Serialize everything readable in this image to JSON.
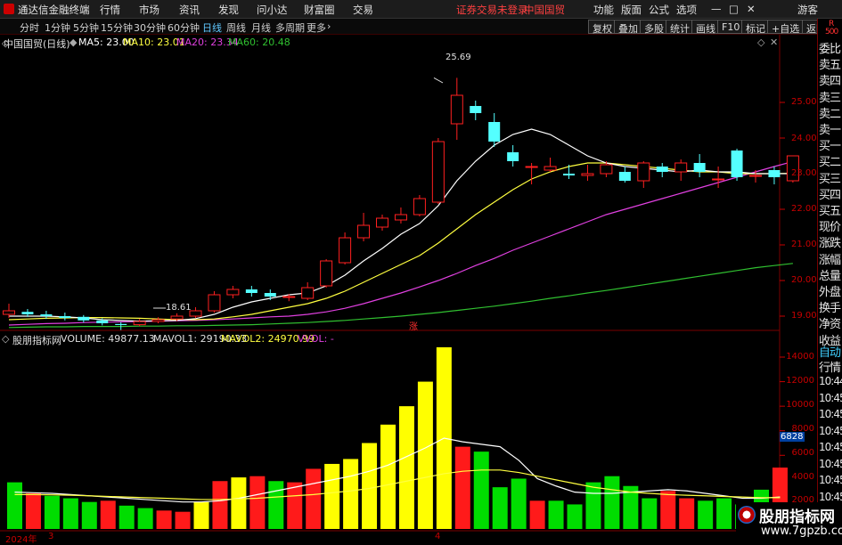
{
  "app": {
    "title": "通达信金融终端",
    "login_status": "证券交易未登录",
    "stock_name_title": "中国国贸",
    "guest": "游客"
  },
  "menu": [
    "行情",
    "市场",
    "资讯",
    "发现",
    "问小达",
    "财富圈",
    "交易"
  ],
  "top_right": [
    "功能",
    "版面",
    "公式",
    "选项"
  ],
  "periods": [
    "分时",
    "1分钟",
    "5分钟",
    "15分钟",
    "30分钟",
    "60分钟",
    "日线",
    "周线",
    "月线",
    "多周期",
    "更多"
  ],
  "active_period": "日线",
  "toolbar_right": [
    "复权",
    "叠加",
    "多股",
    "统计",
    "画线",
    "F10",
    "标记",
    "+自选",
    "返回"
  ],
  "price_header": {
    "name": "中国国贸(日线)",
    "ma5": "MA5: 23.00",
    "ma10": "MA10: 23.01",
    "ma20": "MA20: 23.34",
    "ma60": "MA60: 20.48"
  },
  "price_annotations": {
    "high": "25.69",
    "low": "18.61",
    "zhang": "涨"
  },
  "price_ticks": [
    "25.00",
    "24.00",
    "23.00",
    "22.00",
    "21.00",
    "20.00",
    "19.00"
  ],
  "vol_header": {
    "name": "股朋指标网",
    "volume": "VOLUME: 49877.13",
    "mavol1": "MAVOL1: 29190.33",
    "mavol2": "MAVOL2: 24970.99",
    "vvol": "VVOL: -"
  },
  "vol_ticks": [
    "14000",
    "12000",
    "10000",
    "8000",
    "6000",
    "4000",
    "2000"
  ],
  "vol_cursor": "6828",
  "date_axis": {
    "year": "2024年",
    "m1": "3",
    "m2": "4"
  },
  "right_panel": [
    "委比",
    "卖五",
    "卖四",
    "卖三",
    "卖二",
    "卖一",
    "买一",
    "买二",
    "买三",
    "买四",
    "买五",
    "现价",
    "涨跌",
    "涨幅",
    "总量",
    "外盘",
    "换手",
    "净资",
    "收益"
  ],
  "right_top": {
    "r": "R",
    "n": "500"
  },
  "right_lower": [
    "自动",
    "行情"
  ],
  "tick_times": [
    "10:44",
    "10:45",
    "10:45",
    "10:45",
    "10:45",
    "10:45",
    "10:45",
    "10:45",
    "10:45"
  ],
  "watermark": {
    "name": "股朋指标网",
    "url": "www.7gpzb.com"
  },
  "colors": {
    "up": "#ff2020",
    "down": "#54ffff",
    "ma5": "#ffffff",
    "ma10": "#ffff40",
    "ma20": "#e040e0",
    "ma60": "#30c030",
    "vol_up": "#ff1a1a",
    "vol_down": "#00dd00",
    "vol_yellow": "#ffff00"
  },
  "chart_data": {
    "type": "candlestick",
    "ylim": [
      18.2,
      26.0
    ],
    "candles": [
      {
        "o": 19.05,
        "c": 19.15,
        "h": 19.35,
        "l": 18.95
      },
      {
        "o": 19.12,
        "c": 19.05,
        "h": 19.2,
        "l": 18.98
      },
      {
        "o": 19.05,
        "c": 19.0,
        "h": 19.15,
        "l": 18.92
      },
      {
        "o": 19.0,
        "c": 18.95,
        "h": 19.1,
        "l": 18.88
      },
      {
        "o": 18.98,
        "c": 18.88,
        "h": 19.03,
        "l": 18.82
      },
      {
        "o": 18.88,
        "c": 18.8,
        "h": 18.94,
        "l": 18.74
      },
      {
        "o": 18.78,
        "c": 18.75,
        "h": 18.83,
        "l": 18.61
      },
      {
        "o": 18.76,
        "c": 18.85,
        "h": 18.92,
        "l": 18.72
      },
      {
        "o": 18.85,
        "c": 18.9,
        "h": 18.97,
        "l": 18.8
      },
      {
        "o": 18.92,
        "c": 19.0,
        "h": 19.08,
        "l": 18.86
      },
      {
        "o": 19.0,
        "c": 19.15,
        "h": 19.25,
        "l": 18.95
      },
      {
        "o": 19.15,
        "c": 19.6,
        "h": 19.7,
        "l": 19.1
      },
      {
        "o": 19.6,
        "c": 19.75,
        "h": 19.85,
        "l": 19.5
      },
      {
        "o": 19.75,
        "c": 19.65,
        "h": 19.85,
        "l": 19.55
      },
      {
        "o": 19.65,
        "c": 19.55,
        "h": 19.75,
        "l": 19.45
      },
      {
        "o": 19.55,
        "c": 19.55,
        "h": 19.62,
        "l": 19.42
      },
      {
        "o": 19.5,
        "c": 19.8,
        "h": 19.95,
        "l": 19.45
      },
      {
        "o": 19.85,
        "c": 20.55,
        "h": 20.6,
        "l": 19.8
      },
      {
        "o": 20.5,
        "c": 21.2,
        "h": 21.35,
        "l": 20.45
      },
      {
        "o": 21.2,
        "c": 21.55,
        "h": 21.9,
        "l": 21.1
      },
      {
        "o": 21.5,
        "c": 21.75,
        "h": 21.85,
        "l": 21.4
      },
      {
        "o": 21.7,
        "c": 21.85,
        "h": 22.05,
        "l": 21.6
      },
      {
        "o": 21.85,
        "c": 22.3,
        "h": 22.4,
        "l": 21.8
      },
      {
        "o": 22.2,
        "c": 23.9,
        "h": 24.0,
        "l": 22.15
      },
      {
        "o": 24.4,
        "c": 25.2,
        "h": 25.69,
        "l": 23.95
      },
      {
        "o": 24.9,
        "c": 24.7,
        "h": 25.05,
        "l": 24.5
      },
      {
        "o": 24.45,
        "c": 23.9,
        "h": 24.7,
        "l": 23.75
      },
      {
        "o": 23.6,
        "c": 23.35,
        "h": 23.8,
        "l": 23.2
      },
      {
        "o": 23.2,
        "c": 23.2,
        "h": 23.3,
        "l": 22.7
      },
      {
        "o": 23.1,
        "c": 23.2,
        "h": 23.45,
        "l": 23.05
      },
      {
        "o": 23.0,
        "c": 22.95,
        "h": 23.25,
        "l": 22.85
      },
      {
        "o": 22.95,
        "c": 23.0,
        "h": 23.25,
        "l": 22.8
      },
      {
        "o": 23.0,
        "c": 23.25,
        "h": 23.35,
        "l": 22.9
      },
      {
        "o": 23.05,
        "c": 22.8,
        "h": 23.2,
        "l": 22.75
      },
      {
        "o": 22.8,
        "c": 23.3,
        "h": 23.35,
        "l": 22.6
      },
      {
        "o": 23.2,
        "c": 23.05,
        "h": 23.3,
        "l": 22.9
      },
      {
        "o": 23.05,
        "c": 23.3,
        "h": 23.4,
        "l": 22.8
      },
      {
        "o": 23.3,
        "c": 23.05,
        "h": 23.55,
        "l": 22.9
      },
      {
        "o": 22.85,
        "c": 22.85,
        "h": 23.2,
        "l": 22.6
      },
      {
        "o": 23.65,
        "c": 22.9,
        "h": 23.7,
        "l": 22.8
      },
      {
        "o": 22.95,
        "c": 22.95,
        "h": 23.1,
        "l": 22.75
      },
      {
        "o": 23.1,
        "c": 22.9,
        "h": 23.2,
        "l": 22.7
      },
      {
        "o": 22.8,
        "c": 23.5,
        "h": 23.5,
        "l": 22.75
      }
    ],
    "ma5": [
      19.0,
      19.0,
      19.0,
      18.98,
      18.95,
      18.9,
      18.88,
      18.86,
      18.87,
      18.88,
      18.93,
      19.05,
      19.25,
      19.4,
      19.5,
      19.6,
      19.65,
      19.85,
      20.15,
      20.55,
      20.9,
      21.3,
      21.6,
      22.1,
      22.8,
      23.35,
      23.8,
      24.1,
      24.25,
      24.1,
      23.8,
      23.5,
      23.3,
      23.2,
      23.15,
      23.1,
      23.05,
      23.1,
      23.05,
      23.05,
      23.0,
      23.0,
      23.0
    ],
    "ma10": [
      18.9,
      18.92,
      18.94,
      18.95,
      18.96,
      18.96,
      18.95,
      18.94,
      18.92,
      18.9,
      18.9,
      18.92,
      18.98,
      19.05,
      19.15,
      19.25,
      19.35,
      19.5,
      19.7,
      19.95,
      20.2,
      20.45,
      20.7,
      21.05,
      21.45,
      21.85,
      22.2,
      22.55,
      22.85,
      23.05,
      23.2,
      23.3,
      23.3,
      23.25,
      23.2,
      23.15,
      23.1,
      23.05,
      23.05,
      23.0,
      23.0,
      23.0,
      23.01
    ],
    "ma20": [
      18.75,
      18.77,
      18.79,
      18.8,
      18.82,
      18.83,
      18.84,
      18.85,
      18.86,
      18.87,
      18.88,
      18.9,
      18.92,
      18.95,
      18.98,
      19.0,
      19.05,
      19.12,
      19.22,
      19.35,
      19.5,
      19.65,
      19.82,
      20.0,
      20.2,
      20.42,
      20.62,
      20.85,
      21.05,
      21.25,
      21.45,
      21.65,
      21.85,
      22.0,
      22.15,
      22.3,
      22.45,
      22.6,
      22.75,
      22.9,
      23.05,
      23.2,
      23.34
    ],
    "ma60": [
      18.68,
      18.69,
      18.7,
      18.7,
      18.71,
      18.71,
      18.71,
      18.72,
      18.72,
      18.73,
      18.73,
      18.74,
      18.75,
      18.76,
      18.78,
      18.8,
      18.82,
      18.85,
      18.88,
      18.92,
      18.96,
      19.0,
      19.05,
      19.1,
      19.16,
      19.22,
      19.28,
      19.35,
      19.42,
      19.5,
      19.57,
      19.65,
      19.72,
      19.8,
      19.88,
      19.96,
      20.04,
      20.12,
      20.2,
      20.28,
      20.36,
      20.42,
      20.48
    ],
    "volume_ylim": [
      0,
      15500
    ],
    "volume": [
      {
        "v": 3800,
        "c": "g"
      },
      {
        "v": 2900,
        "c": "r"
      },
      {
        "v": 2700,
        "c": "g"
      },
      {
        "v": 2500,
        "c": "g"
      },
      {
        "v": 2200,
        "c": "g"
      },
      {
        "v": 2300,
        "c": "r"
      },
      {
        "v": 1900,
        "c": "g"
      },
      {
        "v": 1700,
        "c": "g"
      },
      {
        "v": 1500,
        "c": "r"
      },
      {
        "v": 1400,
        "c": "r"
      },
      {
        "v": 2200,
        "c": "y"
      },
      {
        "v": 3900,
        "c": "r"
      },
      {
        "v": 4200,
        "c": "y"
      },
      {
        "v": 4300,
        "c": "r"
      },
      {
        "v": 3900,
        "c": "g"
      },
      {
        "v": 3800,
        "c": "r"
      },
      {
        "v": 4900,
        "c": "r"
      },
      {
        "v": 5300,
        "c": "y"
      },
      {
        "v": 5700,
        "c": "y"
      },
      {
        "v": 7000,
        "c": "y"
      },
      {
        "v": 8500,
        "c": "y"
      },
      {
        "v": 10000,
        "c": "y"
      },
      {
        "v": 12000,
        "c": "y"
      },
      {
        "v": 14800,
        "c": "y"
      },
      {
        "v": 6700,
        "c": "r"
      },
      {
        "v": 6300,
        "c": "g"
      },
      {
        "v": 3400,
        "c": "g"
      },
      {
        "v": 4100,
        "c": "g"
      },
      {
        "v": 2300,
        "c": "r"
      },
      {
        "v": 2300,
        "c": "g"
      },
      {
        "v": 2000,
        "c": "g"
      },
      {
        "v": 3800,
        "c": "g"
      },
      {
        "v": 4300,
        "c": "g"
      },
      {
        "v": 3500,
        "c": "g"
      },
      {
        "v": 2500,
        "c": "g"
      },
      {
        "v": 3100,
        "c": "r"
      },
      {
        "v": 2500,
        "c": "r"
      },
      {
        "v": 2300,
        "c": "g"
      },
      {
        "v": 2500,
        "c": "g"
      },
      {
        "v": 2000,
        "c": "g"
      },
      {
        "v": 3200,
        "c": "g"
      },
      {
        "v": 5000,
        "c": "r"
      }
    ],
    "mavol1": [
      3000,
      2950,
      2900,
      2800,
      2700,
      2600,
      2500,
      2400,
      2300,
      2200,
      2200,
      2300,
      2500,
      2800,
      3100,
      3400,
      3700,
      4000,
      4300,
      4700,
      5200,
      5900,
      6600,
      7400,
      7100,
      6900,
      6700,
      5600,
      4100,
      3500,
      3000,
      2900,
      2900,
      3000,
      3100,
      3200,
      3100,
      2900,
      2700,
      2500,
      2500,
      2600
    ],
    "mavol2": [
      2800,
      2800,
      2780,
      2750,
      2700,
      2650,
      2600,
      2550,
      2500,
      2450,
      2400,
      2400,
      2450,
      2500,
      2600,
      2700,
      2800,
      2950,
      3100,
      3300,
      3600,
      3900,
      4200,
      4500,
      4700,
      4800,
      4800,
      4600,
      4300,
      4000,
      3700,
      3400,
      3200,
      3000,
      2900,
      2800,
      2750,
      2700,
      2650,
      2600,
      2550,
      2550
    ]
  }
}
